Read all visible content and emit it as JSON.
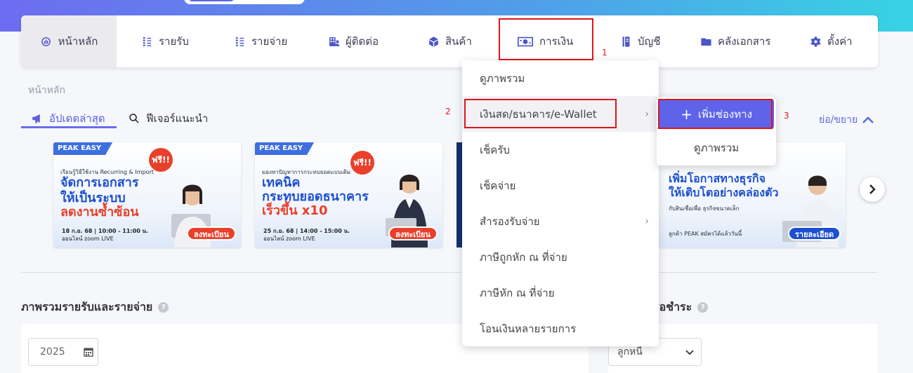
{
  "nav": {
    "items": [
      {
        "label": "หน้าหลัก",
        "icon": "dashboard-icon"
      },
      {
        "label": "รายรับ",
        "icon": "income-icon"
      },
      {
        "label": "รายจ่าย",
        "icon": "expense-icon"
      },
      {
        "label": "ผู้ติดต่อ",
        "icon": "contacts-icon"
      },
      {
        "label": "สินค้า",
        "icon": "product-box-icon"
      },
      {
        "label": "การเงิน",
        "icon": "money-icon"
      },
      {
        "label": "บัญชี",
        "icon": "ledger-icon"
      },
      {
        "label": "คลังเอกสาร",
        "icon": "folder-icon"
      },
      {
        "label": "ตั้งค่า",
        "icon": "gear-icon"
      }
    ]
  },
  "annotations": {
    "n1": "1",
    "n2": "2",
    "n3": "3",
    "highlight_color": "#e0141b"
  },
  "breadcrumb": "หน้าหลัก",
  "tabs": {
    "updates": "อัปเดตล่าสุด",
    "features": "ฟีเจอร์แนะนำ"
  },
  "expand_label": "ย่อ/ขยาย",
  "banners": [
    {
      "brand": "PEAK EASY",
      "free": "ฟรี!!",
      "small": "เรียนรู้วิธีใช้งาน Recurring & Import",
      "line1": "จัดการเอกสาร",
      "line2": "ให้เป็นระบบ",
      "line3": "ลดงานซ้ำซ้อน",
      "date": "18 ก.ย. 68 | 10:00 - 11:00 น.",
      "online": "ออนไลน์ zoom LIVE",
      "cta": "ลงทะเบียน"
    },
    {
      "brand": "PEAK EASY",
      "free": "ฟรี!!",
      "small": "มองหาปัญหาการกระทบยอดแบบเดิม",
      "line1": "เทคนิค",
      "line2": "กระทบยอดธนาคาร",
      "line3": "เร็วขึ้น x10",
      "date": "25 ก.ย. 68 | 14:00 - 15:00 น.",
      "online": "ออนไลน์ zoom LIVE",
      "cta": "ลงทะเบียน"
    },
    {
      "line1": "เพิ่มโอกาสทางธุรกิจ",
      "line2": "ให้เติบโตอย่างคล่องตัว",
      "small": "กับสินเชื่อเพื่อ ธุรกิจขนาดเล็ก",
      "small2": "ลูกค้า PEAK สมัครได้แล้ววันนี้",
      "cta": "รายละเอียด"
    }
  ],
  "sections": {
    "overview_title": "ภาพรวมรายรับและรายจ่าย",
    "pending_title": "รอชำระ"
  },
  "year_field": {
    "value": "2025"
  },
  "select_field": {
    "value": "ลูกหนี้"
  },
  "dropdown": {
    "items": [
      {
        "label": "ดูภาพรวม",
        "has_sub": false
      },
      {
        "label": "เงินสด/ธนาคาร/e-Wallet",
        "has_sub": true
      },
      {
        "label": "เช็ครับ",
        "has_sub": false
      },
      {
        "label": "เช็คจ่าย",
        "has_sub": false
      },
      {
        "label": "สำรองรับจ่าย",
        "has_sub": true
      },
      {
        "label": "ภาษีถูกหัก ณ ที่จ่าย",
        "has_sub": false
      },
      {
        "label": "ภาษีหัก ณ ที่จ่าย",
        "has_sub": false
      },
      {
        "label": "โอนเงินหลายรายการ",
        "has_sub": false
      }
    ],
    "arrow": "›"
  },
  "submenu": {
    "add_label": "เพิ่มช่องทาง",
    "add_icon_glyph": "+",
    "overview_label": "ดูภาพรวม"
  },
  "colors": {
    "accent": "#5e63ea",
    "brand_blue": "#1c4fd0",
    "promo_red": "#e9402b"
  }
}
